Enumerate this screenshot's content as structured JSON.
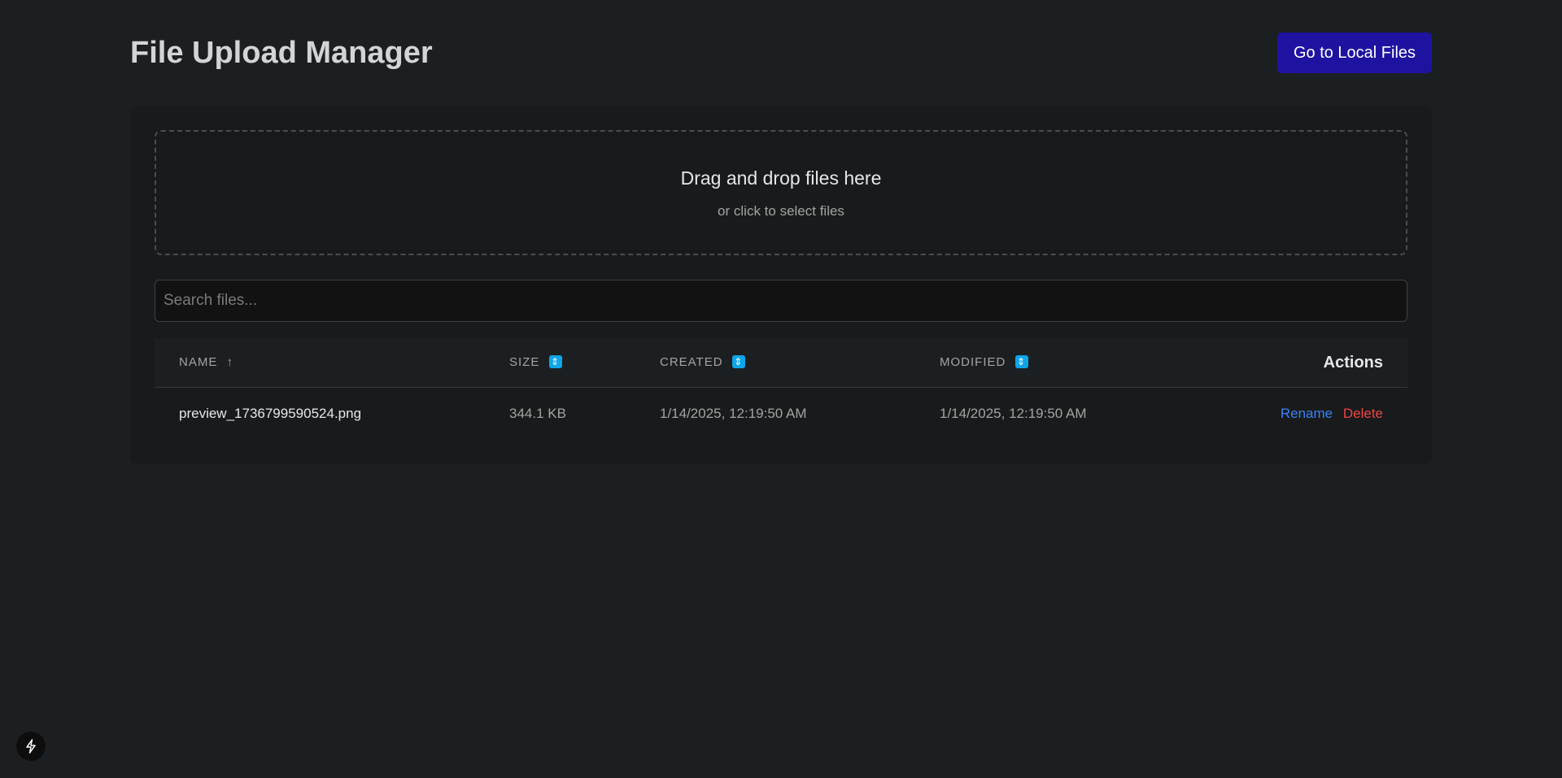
{
  "header": {
    "title": "File Upload Manager",
    "local_files_button": "Go to Local Files"
  },
  "dropzone": {
    "main_text": "Drag and drop files here",
    "sub_text": "or click to select files"
  },
  "search": {
    "placeholder": "Search files...",
    "value": ""
  },
  "table": {
    "columns": {
      "name": "NAME",
      "name_sort": "↑",
      "size": "SIZE",
      "created": "CREATED",
      "modified": "MODIFIED",
      "actions": "Actions"
    },
    "rows": [
      {
        "name": "preview_1736799590524.png",
        "size": "344.1 KB",
        "created": "1/14/2025, 12:19:50 AM",
        "modified": "1/14/2025, 12:19:50 AM",
        "rename_label": "Rename",
        "delete_label": "Delete"
      }
    ]
  },
  "colors": {
    "background": "#1c1f22",
    "panel": "#181a1b",
    "primary_button": "#1e13a1",
    "sort_badge": "#0ea5e9",
    "rename_link": "#3b82f6",
    "delete_link": "#ef4444"
  },
  "icons": {
    "sort": "up-down-arrow-icon",
    "dev_badge": "lightning-icon"
  }
}
